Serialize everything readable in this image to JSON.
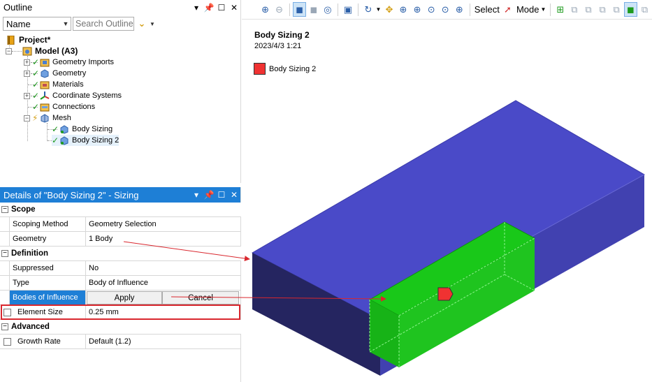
{
  "outline": {
    "title": "Outline",
    "filter_value": "Name",
    "search_placeholder": "Search Outline",
    "tree": {
      "project": "Project*",
      "model": "Model (A3)",
      "geometry_imports": "Geometry Imports",
      "geometry": "Geometry",
      "materials": "Materials",
      "coordinate_systems": "Coordinate Systems",
      "connections": "Connections",
      "mesh": "Mesh",
      "body_sizing": "Body Sizing",
      "body_sizing_2": "Body Sizing 2"
    }
  },
  "details": {
    "title": "Details of \"Body Sizing 2\" - Sizing",
    "scope_section": "Scope",
    "scoping_method_key": "Scoping Method",
    "scoping_method_value": "Geometry Selection",
    "geometry_key": "Geometry",
    "geometry_value": "1 Body",
    "definition_section": "Definition",
    "suppressed_key": "Suppressed",
    "suppressed_value": "No",
    "type_key": "Type",
    "type_value": "Body of Influence",
    "boi_key": "Bodies of Influence",
    "apply_label": "Apply",
    "cancel_label": "Cancel",
    "element_size_key": "Element Size",
    "element_size_value": "0.25 mm",
    "advanced_section": "Advanced",
    "growth_rate_key": "Growth Rate",
    "growth_rate_value": "Default (1.2)"
  },
  "toolbar": {
    "select_label": "Select",
    "mode_label": "Mode"
  },
  "viewport": {
    "title": "Body Sizing 2",
    "date": "2023/4/3 1:21",
    "legend_label": "Body Sizing 2",
    "legend_color": "#f03232",
    "body_color": "#4a4ac8",
    "influence_color": "#19c819"
  }
}
